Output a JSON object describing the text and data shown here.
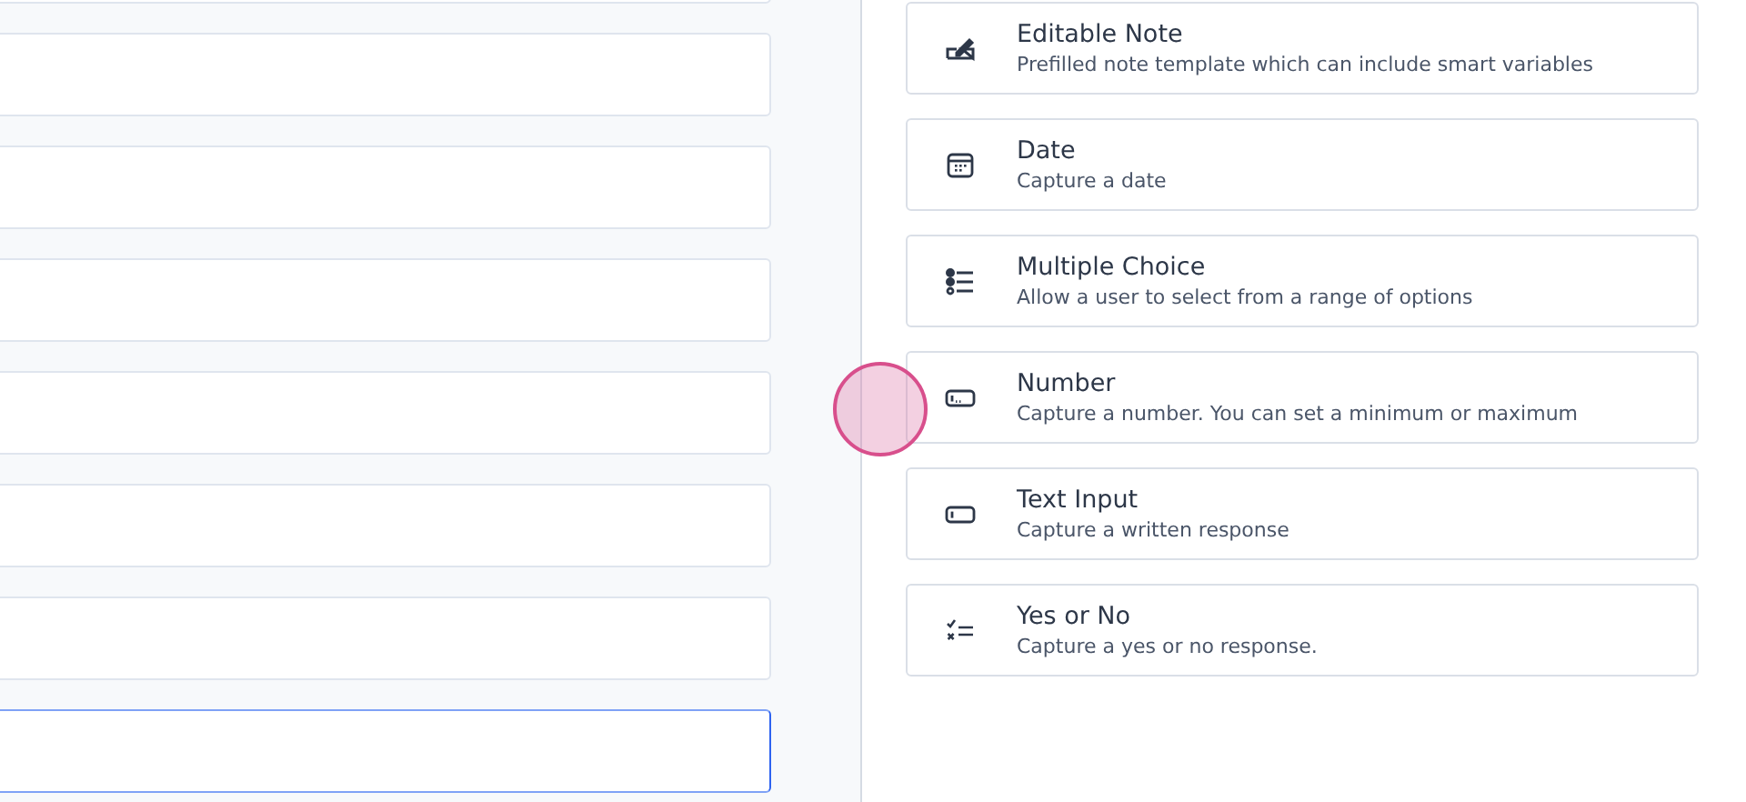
{
  "form_fields": [
    {
      "focused": false
    },
    {
      "focused": false
    },
    {
      "focused": false
    },
    {
      "focused": false
    },
    {
      "focused": false
    },
    {
      "focused": false
    },
    {
      "focused": false
    },
    {
      "focused": true
    }
  ],
  "field_types": [
    {
      "kind": "note",
      "title": "Editable Note",
      "description": "Prefilled note template which can include smart variables"
    },
    {
      "kind": "date",
      "title": "Date",
      "description": "Capture a date"
    },
    {
      "kind": "choice",
      "title": "Multiple Choice",
      "description": "Allow a user to select from a range of options"
    },
    {
      "kind": "number",
      "title": "Number",
      "description": "Capture a number. You can set a minimum or maximum"
    },
    {
      "kind": "text",
      "title": "Text Input",
      "description": "Capture a written response"
    },
    {
      "kind": "yesno",
      "title": "Yes or No",
      "description": "Capture a yes or no response."
    }
  ]
}
